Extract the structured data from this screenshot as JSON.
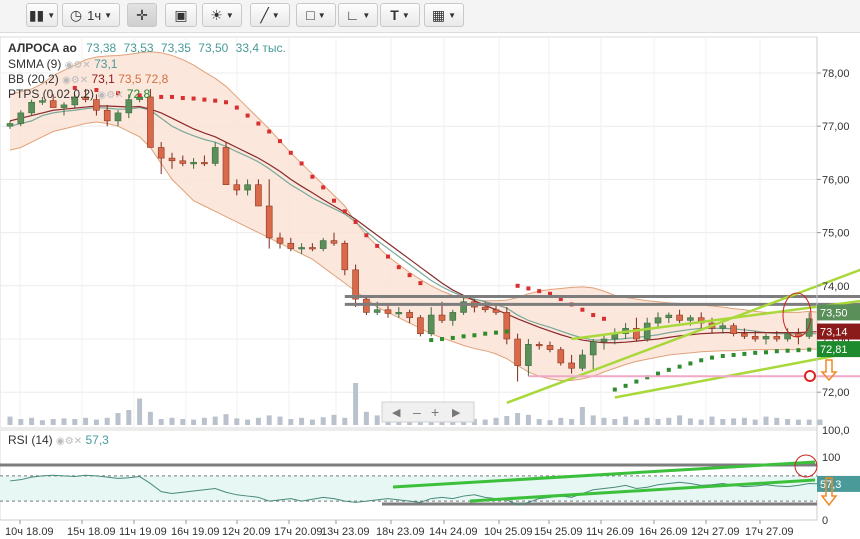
{
  "toolbar": {
    "candle_icon": "candlestick-icon",
    "interval_label": "1ч",
    "text_tool_label": "T"
  },
  "legend": {
    "instrument": "АЛРОСА ао",
    "ohlcv": [
      "73,38",
      "73,53",
      "73,35",
      "73,50",
      "33,4 тыс."
    ],
    "smma_name": "SMMA (9)",
    "smma_val": "73,1",
    "bb_name": "BB (20,2)",
    "bb_vals": [
      "73,1",
      "73,5",
      "72,8"
    ],
    "ptps_name": "PTPS (0.02,0.2)",
    "ptps_val": "72,8",
    "rsi_name": "RSI (14)",
    "rsi_val": "57,3"
  },
  "colors": {
    "up": "#5a8f5a",
    "down": "#d9694a",
    "band_fill": "#fbe3d6",
    "band_line": "#e0a27a",
    "smma": "#7aa89a",
    "bb_mid": "#8b2a2a",
    "ptps_up": "#2e8b2e",
    "ptps_down": "#d83030",
    "trend": "#a8d83a",
    "level": "#888888",
    "pink": "#f0a8c8"
  },
  "chart_data": {
    "type": "candlestick",
    "ylim": [
      71.9,
      78.3
    ],
    "y_ticks": [
      "78,00",
      "77,00",
      "76,00",
      "75,00",
      "74,00",
      "73,00",
      "72,00"
    ],
    "volume_axis_label": "100,0",
    "price_labels": [
      {
        "value": 73.5,
        "text": "73,50",
        "color": "#5a8f5a"
      },
      {
        "value": 73.14,
        "text": "73,14",
        "color": "#8b1a1a"
      },
      {
        "value": 72.81,
        "text": "72,81",
        "color": "#1e8a2e"
      }
    ],
    "x_tick_labels": [
      "10ч 18.09",
      "15ч 18.09",
      "11ч 19.09",
      "16ч 19.09",
      "12ч 20.09",
      "17ч 20.09",
      "13ч 23.09",
      "18ч 23.09",
      "14ч 24.09",
      "10ч 25.09",
      "15ч 25.09",
      "11ч 26.09",
      "16ч 26.09",
      "12ч 27.09",
      "17ч 27.09"
    ],
    "candles": [
      [
        77.0,
        77.1,
        76.95,
        77.05
      ],
      [
        77.05,
        77.3,
        77.0,
        77.25
      ],
      [
        77.25,
        77.5,
        77.2,
        77.45
      ],
      [
        77.45,
        77.55,
        77.4,
        77.48
      ],
      [
        77.48,
        77.6,
        77.4,
        77.35
      ],
      [
        77.35,
        77.45,
        77.2,
        77.4
      ],
      [
        77.4,
        77.6,
        77.35,
        77.55
      ],
      [
        77.55,
        77.7,
        77.45,
        77.5
      ],
      [
        77.5,
        77.6,
        77.2,
        77.3
      ],
      [
        77.3,
        77.4,
        77.0,
        77.1
      ],
      [
        77.1,
        77.3,
        77.0,
        77.25
      ],
      [
        77.25,
        77.6,
        77.15,
        77.5
      ],
      [
        77.5,
        77.6,
        77.45,
        77.55
      ],
      [
        77.55,
        77.7,
        76.6,
        76.6
      ],
      [
        76.6,
        76.7,
        76.1,
        76.4
      ],
      [
        76.4,
        76.5,
        76.2,
        76.35
      ],
      [
        76.35,
        76.45,
        76.25,
        76.3
      ],
      [
        76.3,
        76.4,
        76.2,
        76.32
      ],
      [
        76.32,
        76.45,
        76.25,
        76.3
      ],
      [
        76.3,
        76.7,
        76.25,
        76.6
      ],
      [
        76.6,
        76.7,
        75.9,
        75.9
      ],
      [
        75.9,
        76.0,
        75.7,
        75.8
      ],
      [
        75.8,
        76.0,
        75.7,
        75.9
      ],
      [
        75.9,
        76.0,
        75.5,
        75.5
      ],
      [
        75.5,
        76.0,
        74.7,
        74.9
      ],
      [
        74.9,
        75.0,
        74.7,
        74.8
      ],
      [
        74.8,
        74.9,
        74.65,
        74.7
      ],
      [
        74.7,
        74.8,
        74.6,
        74.72
      ],
      [
        74.72,
        74.8,
        74.65,
        74.7
      ],
      [
        74.7,
        74.9,
        74.65,
        74.85
      ],
      [
        74.85,
        75.0,
        74.75,
        74.8
      ],
      [
        74.8,
        74.85,
        74.2,
        74.3
      ],
      [
        74.3,
        74.4,
        73.6,
        73.75
      ],
      [
        73.75,
        73.8,
        73.45,
        73.5
      ],
      [
        73.5,
        73.7,
        73.45,
        73.55
      ],
      [
        73.55,
        73.65,
        73.4,
        73.48
      ],
      [
        73.48,
        73.6,
        73.4,
        73.5
      ],
      [
        73.5,
        73.55,
        73.3,
        73.4
      ],
      [
        73.4,
        73.45,
        73.05,
        73.1
      ],
      [
        73.1,
        73.6,
        73.05,
        73.45
      ],
      [
        73.45,
        73.7,
        73.3,
        73.35
      ],
      [
        73.35,
        73.55,
        73.25,
        73.5
      ],
      [
        73.5,
        73.8,
        73.45,
        73.7
      ],
      [
        73.7,
        73.75,
        73.5,
        73.6
      ],
      [
        73.6,
        73.7,
        73.5,
        73.55
      ],
      [
        73.55,
        73.65,
        73.45,
        73.5
      ],
      [
        73.5,
        73.6,
        72.9,
        73.0
      ],
      [
        73.0,
        73.1,
        72.2,
        72.5
      ],
      [
        72.5,
        73.0,
        72.3,
        72.9
      ],
      [
        72.9,
        72.95,
        72.8,
        72.88
      ],
      [
        72.88,
        72.95,
        72.75,
        72.8
      ],
      [
        72.8,
        72.85,
        72.5,
        72.55
      ],
      [
        72.55,
        72.7,
        72.35,
        72.45
      ],
      [
        72.45,
        72.8,
        72.4,
        72.7
      ],
      [
        72.7,
        73.0,
        72.4,
        72.95
      ],
      [
        72.95,
        73.1,
        72.8,
        73.0
      ],
      [
        73.0,
        73.2,
        72.9,
        73.1
      ],
      [
        73.1,
        73.3,
        73.0,
        73.2
      ],
      [
        73.2,
        73.4,
        72.95,
        73.0
      ],
      [
        73.0,
        73.4,
        72.95,
        73.3
      ],
      [
        73.3,
        73.5,
        73.2,
        73.4
      ],
      [
        73.4,
        73.5,
        73.3,
        73.45
      ],
      [
        73.45,
        73.55,
        73.3,
        73.35
      ],
      [
        73.35,
        73.45,
        73.25,
        73.4
      ],
      [
        73.4,
        73.5,
        73.2,
        73.3
      ],
      [
        73.3,
        73.4,
        73.1,
        73.2
      ],
      [
        73.2,
        73.3,
        73.1,
        73.25
      ],
      [
        73.25,
        73.3,
        73.05,
        73.1
      ],
      [
        73.1,
        73.2,
        73.0,
        73.05
      ],
      [
        73.05,
        73.15,
        72.95,
        73.0
      ],
      [
        73.0,
        73.1,
        72.9,
        73.05
      ],
      [
        73.05,
        73.15,
        72.95,
        73.0
      ],
      [
        73.0,
        73.2,
        72.95,
        73.1
      ],
      [
        73.1,
        73.2,
        72.9,
        73.05
      ],
      [
        73.05,
        73.5,
        73.0,
        73.38
      ],
      [
        73.38,
        73.53,
        73.35,
        73.5
      ]
    ],
    "volumes": [
      14,
      10,
      12,
      8,
      10,
      11,
      10,
      12,
      9,
      12,
      20,
      25,
      44,
      22,
      10,
      12,
      10,
      9,
      12,
      14,
      18,
      11,
      9,
      12,
      16,
      14,
      10,
      12,
      9,
      13,
      17,
      12,
      70,
      22,
      16,
      8,
      10,
      9,
      12,
      10,
      8,
      9,
      12,
      10,
      9,
      12,
      15,
      20,
      17,
      10,
      8,
      12,
      10,
      30,
      16,
      12,
      10,
      14,
      9,
      12,
      10,
      12,
      16,
      11,
      9,
      14,
      10,
      11,
      12,
      9,
      14,
      12,
      10,
      9,
      9,
      9
    ],
    "smma": [
      77.0,
      77.05,
      77.1,
      77.2,
      77.25,
      77.28,
      77.3,
      77.33,
      77.35,
      77.34,
      77.32,
      77.32,
      77.35,
      77.3,
      77.15,
      77.0,
      76.9,
      76.82,
      76.75,
      76.7,
      76.62,
      76.52,
      76.43,
      76.33,
      76.2,
      76.05,
      75.9,
      75.78,
      75.65,
      75.55,
      75.45,
      75.35,
      75.2,
      75.02,
      74.85,
      74.7,
      74.55,
      74.4,
      74.25,
      74.1,
      73.98,
      73.88,
      73.8,
      73.75,
      73.7,
      73.65,
      73.58,
      73.45,
      73.35,
      73.28,
      73.22,
      73.15,
      73.08,
      73.02,
      72.98,
      72.98,
      72.99,
      73.01,
      73.03,
      73.05,
      73.08,
      73.12,
      73.15,
      73.18,
      73.2,
      73.2,
      73.2,
      73.19,
      73.17,
      73.15,
      73.12,
      73.1,
      73.1,
      73.09,
      73.1,
      73.1
    ],
    "bb_mid": [
      77.1,
      77.15,
      77.2,
      77.25,
      77.3,
      77.32,
      77.34,
      77.36,
      77.38,
      77.38,
      77.37,
      77.36,
      77.37,
      77.32,
      77.25,
      77.15,
      77.05,
      76.95,
      76.87,
      76.8,
      76.7,
      76.6,
      76.5,
      76.4,
      76.28,
      76.15,
      76.0,
      75.87,
      75.75,
      75.62,
      75.5,
      75.38,
      75.25,
      75.1,
      74.95,
      74.8,
      74.65,
      74.5,
      74.35,
      74.2,
      74.05,
      73.92,
      73.82,
      73.72,
      73.63,
      73.55,
      73.47,
      73.38,
      73.3,
      73.22,
      73.15,
      73.08,
      73.02,
      72.98,
      72.95,
      72.93,
      72.93,
      72.94,
      72.96,
      72.98,
      73.0,
      73.03,
      73.06,
      73.08,
      73.1,
      73.11,
      73.12,
      73.12,
      73.12,
      73.12,
      73.12,
      73.12,
      73.12,
      73.12,
      73.13,
      73.14
    ],
    "bb_upper": [
      77.6,
      77.65,
      77.7,
      77.8,
      77.95,
      78.05,
      78.15,
      78.25,
      78.3,
      78.32,
      78.33,
      78.35,
      78.38,
      78.4,
      78.38,
      78.33,
      78.25,
      78.15,
      78.02,
      77.9,
      77.75,
      77.55,
      77.35,
      77.15,
      76.95,
      76.72,
      76.5,
      76.3,
      76.1,
      75.9,
      75.7,
      75.5,
      75.2,
      74.95,
      74.75,
      74.55,
      74.4,
      74.25,
      74.12,
      74.0,
      73.9,
      73.82,
      73.77,
      73.74,
      73.72,
      73.72,
      73.73,
      73.78,
      73.85,
      73.9,
      73.93,
      73.95,
      73.97,
      73.98,
      73.96,
      73.9,
      73.82,
      73.78,
      73.75,
      73.72,
      73.7,
      73.68,
      73.67,
      73.66,
      73.64,
      73.62,
      73.6,
      73.57,
      73.55,
      73.52,
      73.5,
      73.5,
      73.5,
      73.5,
      73.52,
      73.5
    ],
    "bb_lower": [
      76.55,
      76.6,
      76.7,
      76.8,
      76.9,
      76.95,
      77.0,
      77.05,
      77.08,
      77.05,
      77.0,
      76.9,
      76.8,
      76.6,
      76.3,
      76.0,
      75.8,
      75.6,
      75.5,
      75.4,
      75.3,
      75.2,
      75.1,
      75.0,
      74.9,
      74.8,
      74.7,
      74.6,
      74.5,
      74.35,
      74.2,
      74.05,
      73.9,
      73.75,
      73.6,
      73.5,
      73.4,
      73.3,
      73.2,
      73.1,
      73.02,
      72.95,
      72.88,
      72.82,
      72.78,
      72.72,
      72.63,
      72.5,
      72.38,
      72.3,
      72.25,
      72.22,
      72.22,
      72.25,
      72.3,
      72.38,
      72.45,
      72.52,
      72.58,
      72.62,
      72.66,
      72.7,
      72.72,
      72.74,
      72.76,
      72.77,
      72.78,
      72.78,
      72.79,
      72.8,
      72.8,
      72.8,
      72.8,
      72.8,
      72.81,
      72.81
    ],
    "sar": [
      [
        6,
        77.72,
        "d"
      ],
      [
        8,
        77.68,
        "d"
      ],
      [
        10,
        77.62,
        "d"
      ],
      [
        12,
        77.58,
        "d"
      ],
      [
        14,
        77.55,
        "d"
      ],
      [
        15,
        77.55,
        "d"
      ],
      [
        16,
        77.53,
        "d"
      ],
      [
        17,
        77.52,
        "d"
      ],
      [
        18,
        77.5,
        "d"
      ],
      [
        19,
        77.48,
        "d"
      ],
      [
        20,
        77.45,
        "d"
      ],
      [
        21,
        77.35,
        "d"
      ],
      [
        22,
        77.2,
        "d"
      ],
      [
        23,
        77.05,
        "d"
      ],
      [
        24,
        76.9,
        "d"
      ],
      [
        25,
        76.72,
        "d"
      ],
      [
        26,
        76.5,
        "d"
      ],
      [
        27,
        76.3,
        "d"
      ],
      [
        28,
        76.05,
        "d"
      ],
      [
        29,
        75.85,
        "d"
      ],
      [
        30,
        75.6,
        "d"
      ],
      [
        31,
        75.4,
        "d"
      ],
      [
        32,
        75.2,
        "d"
      ],
      [
        33,
        74.95,
        "d"
      ],
      [
        34,
        74.75,
        "d"
      ],
      [
        35,
        74.55,
        "d"
      ],
      [
        36,
        74.35,
        "d"
      ],
      [
        37,
        74.2,
        "d"
      ],
      [
        38,
        74.05,
        "d"
      ],
      [
        39,
        72.98,
        "u"
      ],
      [
        40,
        73.0,
        "u"
      ],
      [
        41,
        73.02,
        "u"
      ],
      [
        42,
        73.05,
        "u"
      ],
      [
        43,
        73.07,
        "u"
      ],
      [
        44,
        73.1,
        "u"
      ],
      [
        45,
        73.12,
        "u"
      ],
      [
        46,
        73.14,
        "u"
      ],
      [
        47,
        74.0,
        "d"
      ],
      [
        48,
        73.95,
        "d"
      ],
      [
        49,
        73.9,
        "d"
      ],
      [
        50,
        73.85,
        "d"
      ],
      [
        51,
        73.75,
        "d"
      ],
      [
        52,
        73.65,
        "d"
      ],
      [
        53,
        73.55,
        "d"
      ],
      [
        54,
        73.45,
        "d"
      ],
      [
        55,
        73.38,
        "d"
      ],
      [
        56,
        72.05,
        "u"
      ],
      [
        57,
        72.12,
        "u"
      ],
      [
        58,
        72.2,
        "u"
      ],
      [
        59,
        72.28,
        "u"
      ],
      [
        60,
        72.35,
        "u"
      ],
      [
        61,
        72.42,
        "u"
      ],
      [
        62,
        72.48,
        "u"
      ],
      [
        63,
        72.54,
        "u"
      ],
      [
        64,
        72.6,
        "u"
      ],
      [
        65,
        72.65,
        "u"
      ],
      [
        66,
        72.68,
        "u"
      ],
      [
        67,
        72.7,
        "u"
      ],
      [
        68,
        72.72,
        "u"
      ],
      [
        69,
        72.74,
        "u"
      ],
      [
        70,
        72.75,
        "u"
      ],
      [
        71,
        72.77,
        "u"
      ],
      [
        72,
        72.78,
        "u"
      ],
      [
        73,
        72.79,
        "u"
      ],
      [
        74,
        72.8,
        "u"
      ],
      [
        75,
        72.81,
        "u"
      ]
    ],
    "rsi": {
      "ylim": [
        0,
        100
      ],
      "y_ticks": [
        "100",
        "0"
      ],
      "levels": [
        70,
        30
      ],
      "values": [
        62,
        64,
        68,
        70,
        71,
        70,
        69,
        71,
        70,
        68,
        66,
        67,
        69,
        58,
        45,
        42,
        44,
        46,
        48,
        50,
        44,
        40,
        38,
        36,
        30,
        32,
        34,
        30,
        33,
        36,
        34,
        30,
        28,
        30,
        32,
        34,
        32,
        30,
        28,
        34,
        36,
        34,
        38,
        40,
        36,
        34,
        32,
        24,
        28,
        34,
        36,
        38,
        36,
        42,
        48,
        50,
        52,
        55,
        50,
        52,
        56,
        58,
        60,
        58,
        55,
        56,
        58,
        55,
        53,
        54,
        56,
        54,
        53,
        55,
        58,
        57.3
      ]
    },
    "drawings": [
      {
        "kind": "level",
        "y": 73.8,
        "from": 31,
        "to": 82
      },
      {
        "kind": "level",
        "y": 73.65,
        "from": 31,
        "to": 82
      },
      {
        "kind": "trend",
        "from": [
          46,
          71.8
        ],
        "to": [
          82,
          74.55
        ]
      },
      {
        "kind": "trend",
        "from": [
          52,
          73.0
        ],
        "to": [
          82,
          73.8
        ]
      },
      {
        "kind": "trend",
        "from": [
          56,
          71.9
        ],
        "to": [
          82,
          72.9
        ]
      },
      {
        "kind": "pink_level",
        "y": 72.3,
        "from": 48,
        "to": 82
      }
    ]
  }
}
